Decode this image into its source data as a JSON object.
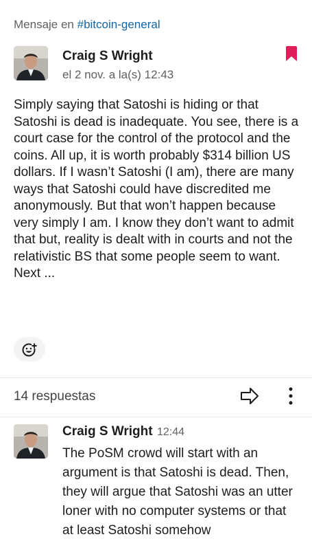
{
  "context": {
    "prefix": "Mensaje en ",
    "channel": "#bitcoin-general"
  },
  "post": {
    "author": "Craig S Wright",
    "timestamp": "el 2 nov. a la(s) 12:43",
    "text": "Simply saying that Satoshi is hiding or that Satoshi is dead is inadequate. You see, there is a court case for the control of the protocol and the coins. All up, it is worth probably $314 billion US dollars. If I wasn’t Satoshi (I am), there are many ways that Satoshi could have discredited me anonymously. But that won’t happen because very simply I am. I know they don’t want to admit that but, reality is dealt with in courts and not the relativistic BS that some people seem to want.\nNext ...",
    "bookmark_color": "#e01e5a"
  },
  "thread": {
    "replies_label": "14 respuestas"
  },
  "reply": {
    "author": "Craig S Wright",
    "time": "12:44",
    "text": "The PoSM crowd will start with an argument is that Satoshi is dead. Then, they will argue that Satoshi was an utter loner with no computer systems or that at least Satoshi somehow"
  },
  "icons": {
    "bookmark": "bookmark-icon",
    "reaction": "add-reaction-icon",
    "share": "share-forward-icon",
    "more": "more-vertical-icon"
  }
}
